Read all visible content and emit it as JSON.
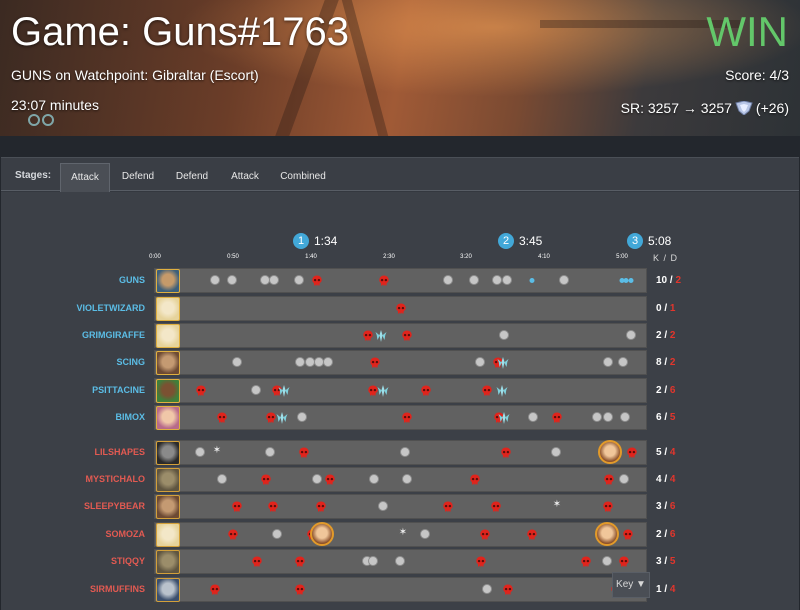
{
  "header": {
    "title": "Game: Guns#1763",
    "map_line": "GUNS on Watchpoint: Gibraltar (Escort)",
    "duration": "23:07 minutes",
    "result": "WIN",
    "score": "Score: 4/3",
    "sr_text": "SR: 3257 → 3257",
    "sr_delta": "(+26)",
    "result_color": "#63c76a"
  },
  "tabs": {
    "label": "Stages:",
    "items": [
      "Attack",
      "Defend",
      "Defend",
      "Attack",
      "Combined"
    ],
    "active": 0
  },
  "stage_markers": [
    {
      "num": "1",
      "time": "1:34"
    },
    {
      "num": "2",
      "time": "3:45"
    },
    {
      "num": "3",
      "time": "5:08"
    }
  ],
  "ticks": [
    "0:00",
    "0:50",
    "1:40",
    "2:30",
    "3:20",
    "4:10",
    "5:00"
  ],
  "kd_header": "K / D",
  "players": [
    {
      "name": "GUNS",
      "team": "blue",
      "hero_icon": "hero-portrait-blue-icon",
      "kills": "10",
      "deaths": "2",
      "events": [
        [
          "kill",
          214
        ],
        [
          "kill",
          231
        ],
        [
          "kill",
          264
        ],
        [
          "kill",
          273
        ],
        [
          "kill",
          298
        ],
        [
          "death",
          316
        ],
        [
          "death",
          383
        ],
        [
          "kill",
          447
        ],
        [
          "kill",
          473
        ],
        [
          "kill",
          496
        ],
        [
          "kill",
          506
        ],
        [
          "dot",
          531
        ],
        [
          "kill",
          563
        ],
        [
          "dot",
          621
        ],
        [
          "dot",
          625
        ],
        [
          "dot",
          630
        ]
      ]
    },
    {
      "name": "VIOLETWIZARD",
      "team": "blue",
      "hero_icon": "hero-portrait-mercy-icon",
      "kills": "0",
      "deaths": "1",
      "events": [
        [
          "death",
          400
        ]
      ]
    },
    {
      "name": "GRIMGIRAFFE",
      "team": "blue",
      "hero_icon": "hero-portrait-mercy-icon",
      "kills": "2",
      "deaths": "2",
      "events": [
        [
          "death",
          367
        ],
        [
          "ult",
          380
        ],
        [
          "death",
          406
        ],
        [
          "kill",
          503
        ],
        [
          "kill",
          630
        ]
      ]
    },
    {
      "name": "SCING",
      "team": "blue",
      "hero_icon": "hero-portrait-mccree-icon",
      "kills": "8",
      "deaths": "2",
      "events": [
        [
          "kill",
          236
        ],
        [
          "kill",
          299
        ],
        [
          "kill",
          309
        ],
        [
          "kill",
          318
        ],
        [
          "kill",
          327
        ],
        [
          "death",
          374
        ],
        [
          "kill",
          479
        ],
        [
          "death",
          497
        ],
        [
          "ult",
          502
        ],
        [
          "kill",
          607
        ],
        [
          "kill",
          622
        ]
      ]
    },
    {
      "name": "PSITTACINE",
      "team": "blue",
      "hero_icon": "hero-portrait-lucio-icon",
      "kills": "2",
      "deaths": "6",
      "events": [
        [
          "death",
          200
        ],
        [
          "kill",
          255
        ],
        [
          "death",
          276
        ],
        [
          "ult",
          283
        ],
        [
          "death",
          372
        ],
        [
          "ult",
          382
        ],
        [
          "death",
          425
        ],
        [
          "death",
          486
        ],
        [
          "ult",
          501
        ]
      ]
    },
    {
      "name": "BIMOX",
      "team": "blue",
      "hero_icon": "hero-portrait-dva-icon",
      "kills": "6",
      "deaths": "5",
      "events": [
        [
          "death",
          221
        ],
        [
          "death",
          270
        ],
        [
          "ult",
          281
        ],
        [
          "kill",
          301
        ],
        [
          "death",
          406
        ],
        [
          "death",
          498
        ],
        [
          "ult",
          503
        ],
        [
          "kill",
          532
        ],
        [
          "death",
          556
        ],
        [
          "kill",
          596
        ],
        [
          "kill",
          607
        ],
        [
          "kill",
          624
        ]
      ]
    },
    {
      "name": "LILSHAPES",
      "team": "red",
      "hero_icon": "hero-portrait-reaper-icon",
      "kills": "5",
      "deaths": "4",
      "events": [
        [
          "kill",
          199
        ],
        [
          "star",
          216
        ],
        [
          "kill",
          269
        ],
        [
          "death",
          303
        ],
        [
          "kill",
          404
        ],
        [
          "death",
          505
        ],
        [
          "kill",
          555
        ],
        [
          "avatar",
          609
        ],
        [
          "death",
          631
        ]
      ]
    },
    {
      "name": "MYSTICHALO",
      "team": "red",
      "hero_icon": "hero-portrait-roadhog-icon",
      "kills": "4",
      "deaths": "4",
      "events": [
        [
          "kill",
          221
        ],
        [
          "death",
          265
        ],
        [
          "kill",
          316
        ],
        [
          "death",
          329
        ],
        [
          "kill",
          373
        ],
        [
          "kill",
          406
        ],
        [
          "death",
          474
        ],
        [
          "death",
          608
        ],
        [
          "kill",
          623
        ]
      ]
    },
    {
      "name": "SLEEPYBEAR",
      "team": "red",
      "hero_icon": "hero-portrait-mccree-icon",
      "kills": "3",
      "deaths": "6",
      "events": [
        [
          "death",
          236
        ],
        [
          "death",
          272
        ],
        [
          "death",
          320
        ],
        [
          "kill",
          382
        ],
        [
          "death",
          447
        ],
        [
          "death",
          495
        ],
        [
          "star",
          556
        ],
        [
          "death",
          607
        ]
      ]
    },
    {
      "name": "SOMOZA",
      "team": "red",
      "hero_icon": "hero-portrait-mercy-icon",
      "kills": "2",
      "deaths": "6",
      "events": [
        [
          "death",
          232
        ],
        [
          "kill",
          276
        ],
        [
          "death",
          311
        ],
        [
          "avatar",
          321
        ],
        [
          "star",
          402
        ],
        [
          "kill",
          424
        ],
        [
          "death",
          484
        ],
        [
          "death",
          531
        ],
        [
          "avatar",
          606
        ],
        [
          "death",
          627
        ]
      ]
    },
    {
      "name": "STIQQY",
      "team": "red",
      "hero_icon": "hero-portrait-roadhog-icon",
      "kills": "3",
      "deaths": "5",
      "events": [
        [
          "death",
          256
        ],
        [
          "death",
          299
        ],
        [
          "kill",
          366
        ],
        [
          "kill",
          372
        ],
        [
          "kill",
          399
        ],
        [
          "death",
          480
        ],
        [
          "death",
          585
        ],
        [
          "kill",
          606
        ],
        [
          "death",
          623
        ]
      ]
    },
    {
      "name": "SIRMUFFINS",
      "team": "red",
      "hero_icon": "hero-portrait-ana-icon",
      "kills": "1",
      "deaths": "4",
      "events": [
        [
          "death",
          214
        ],
        [
          "death",
          299
        ],
        [
          "kill",
          486
        ],
        [
          "death",
          507
        ],
        [
          "death",
          615
        ]
      ]
    }
  ],
  "key_button": "Key ▼"
}
